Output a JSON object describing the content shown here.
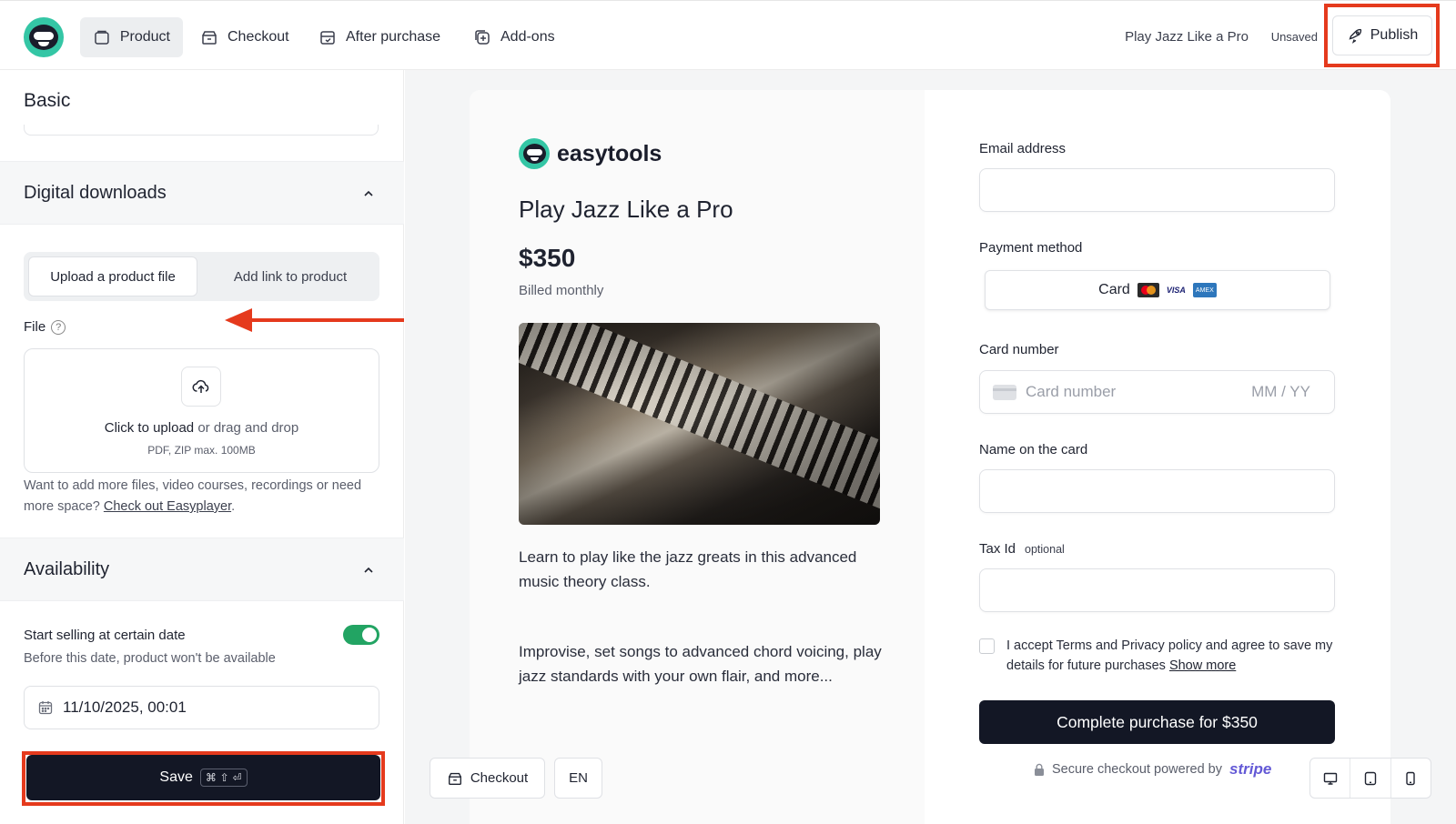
{
  "nav": {
    "tabs": [
      {
        "label": "Product",
        "icon": "product-icon",
        "active": true
      },
      {
        "label": "Checkout",
        "icon": "checkout-icon"
      },
      {
        "label": "After purchase",
        "icon": "after-purchase-icon"
      },
      {
        "label": "Add-ons",
        "icon": "add-ons-icon"
      }
    ],
    "product_name": "Play Jazz Like a Pro",
    "status": "Unsaved",
    "publish_label": "Publish"
  },
  "left": {
    "basic_title": "Basic",
    "digital_downloads": {
      "title": "Digital downloads",
      "tab_upload": "Upload a product file",
      "tab_link": "Add link to product",
      "file_label": "File",
      "help_glyph": "?",
      "dropzone_action": "Click to upload",
      "dropzone_rest": "or drag and drop",
      "dropzone_hint": "PDF, ZIP max. 100MB",
      "more_text": "Want to add more files, video courses, recordings or need more space?",
      "more_link": "Check out Easyplayer"
    },
    "availability": {
      "title": "Availability",
      "start_title": "Start selling at certain date",
      "start_sub": "Before this date, product won't be available",
      "toggle_on": true,
      "date_value": "11/10/2025, 00:01"
    },
    "save_label": "Save",
    "save_shortcut": "⌘ ⇧ ⏎"
  },
  "preview": {
    "brand": "easytools",
    "product_title": "Play Jazz Like a Pro",
    "price": "$350",
    "billing": "Billed monthly",
    "desc1": "Learn to play like the jazz greats in this advanced music theory class.",
    "desc2": "Improvise, set songs to advanced chord voicing, play jazz standards with your own flair, and more...",
    "form": {
      "email_label": "Email address",
      "payment_label": "Payment method",
      "payment_option": "Card",
      "visa_text": "VISA",
      "amex_text": "AMEX",
      "card_number_label": "Card number",
      "card_number_placeholder": "Card number",
      "expiry_placeholder": "MM / YY",
      "name_label": "Name on the card",
      "tax_label": "Tax Id",
      "tax_optional": "optional",
      "terms_text": "I accept Terms and Privacy policy and agree to save my details for future purchases",
      "terms_link": "Show more",
      "complete_label": "Complete purchase for $350",
      "secure_text": "Secure checkout powered by",
      "secure_brand": "stripe"
    },
    "bottom": {
      "checkout_label": "Checkout",
      "lang_label": "EN"
    }
  },
  "colors": {
    "accent_dark": "#131725",
    "brand_teal": "#34c6a5",
    "toggle_green": "#22a463",
    "highlight_red": "#e53a1d",
    "stripe_purple": "#6359d6"
  }
}
